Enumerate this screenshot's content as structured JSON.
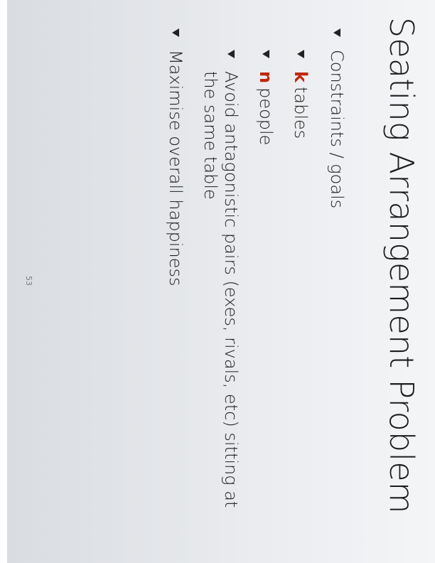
{
  "slide": {
    "title": "Seating Arrangement Problem",
    "bullets": [
      {
        "level": 1,
        "text": "Constraints / goals"
      },
      {
        "level": 2,
        "var": "k",
        "text": "tables"
      },
      {
        "level": 2,
        "var": "n",
        "text": "people"
      },
      {
        "level": 2,
        "text": "Avoid antagonistic pairs (exes, rivals, etc) sitting at the same table"
      },
      {
        "level": 1,
        "text": "Maximise overall happiness"
      }
    ],
    "page_number": "53",
    "colors": {
      "variable": "#c0280f",
      "text": "#1c1c1c",
      "background": "#e9ebee"
    },
    "orientation": "rotated 90 degrees clockwise"
  }
}
